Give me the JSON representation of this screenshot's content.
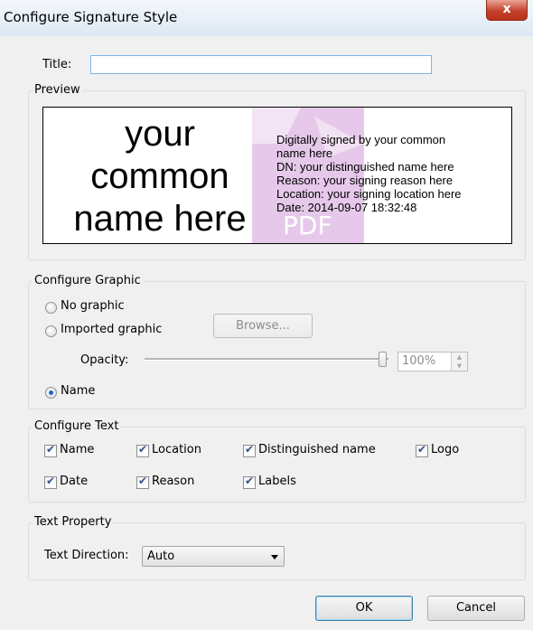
{
  "window": {
    "title": "Configure Signature Style",
    "close_label": "x"
  },
  "title_field": {
    "label": "Title:",
    "value": "",
    "placeholder": ""
  },
  "preview": {
    "legend": "Preview",
    "name_lines": [
      "your",
      "common",
      "name here"
    ],
    "detail_lines": [
      "Digitally signed by your common",
      "name here",
      "DN: your distinguished name here",
      "Reason: your signing reason here",
      "Location: your signing location here",
      "Date: 2014-09-07 18:32:48"
    ],
    "watermark_text": "PDF"
  },
  "configure_graphic": {
    "legend": "Configure Graphic",
    "options": [
      {
        "label": "No graphic",
        "selected": false
      },
      {
        "label": "Imported graphic",
        "selected": false
      },
      {
        "label": "Name",
        "selected": true
      }
    ],
    "browse_label": "Browse...",
    "opacity_label": "Opacity:",
    "opacity_value": "100%",
    "opacity_level": 1.0
  },
  "configure_text": {
    "legend": "Configure Text",
    "items": [
      {
        "label": "Name",
        "checked": true
      },
      {
        "label": "Location",
        "checked": true
      },
      {
        "label": "Distinguished name",
        "checked": true
      },
      {
        "label": "Logo",
        "checked": true
      },
      {
        "label": "Date",
        "checked": true
      },
      {
        "label": "Reason",
        "checked": true
      },
      {
        "label": "Labels",
        "checked": true
      }
    ]
  },
  "text_property": {
    "legend": "Text Property",
    "direction_label": "Text Direction:",
    "direction_value": "Auto"
  },
  "buttons": {
    "ok_label": "OK",
    "cancel_label": "Cancel"
  },
  "colors": {
    "accent": "#2a62c9",
    "close_button": "#c4412c",
    "watermark": "#c070c8"
  }
}
